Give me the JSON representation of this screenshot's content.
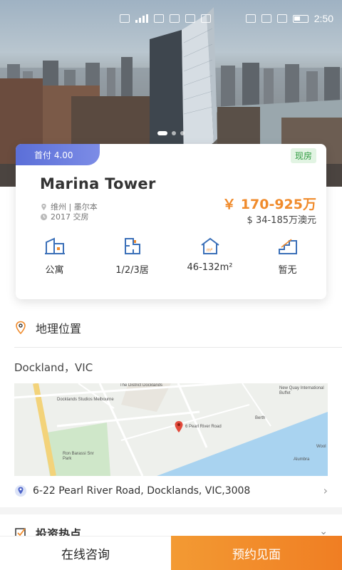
{
  "status_bar": {
    "time": "2:50"
  },
  "property": {
    "down_payment": "首付 4.00",
    "status": "现房",
    "name": "Marina Tower",
    "location": "维州 | 墨尔本",
    "completion": "2017 交房",
    "price_cny": "￥ 170-925万",
    "price_aud": "$ 34-185万澳元"
  },
  "features": [
    {
      "label": "公寓",
      "icon": "building-icon"
    },
    {
      "label": "1/2/3居",
      "icon": "floorplan-icon"
    },
    {
      "label": "46-132m²",
      "icon": "area-house-icon"
    },
    {
      "label": "暂无",
      "icon": "stairs-icon"
    }
  ],
  "location_section": {
    "title": "地理位置",
    "region": "Dockland，VIC",
    "address": "6-22 Pearl River Road, Docklands, VIC,3008"
  },
  "map_labels": {
    "district": "The District Docklands",
    "studios": "Docklands Studios Melbourne",
    "pin": "6 Pearl River Road",
    "park": "Ron Barassi Snr Park",
    "newquay": "New Quay International Buffet",
    "berth": "Berth",
    "alumbra": "Alumbra",
    "woolworths": "Wool"
  },
  "next_section": {
    "title": "投资热点"
  },
  "bottom": {
    "consult_label": "在线咨询",
    "book_label": "预约见面"
  },
  "colors": {
    "accent": "#f08b2c",
    "badge": "#5b6fd8",
    "status_green": "#2e9b3f"
  }
}
